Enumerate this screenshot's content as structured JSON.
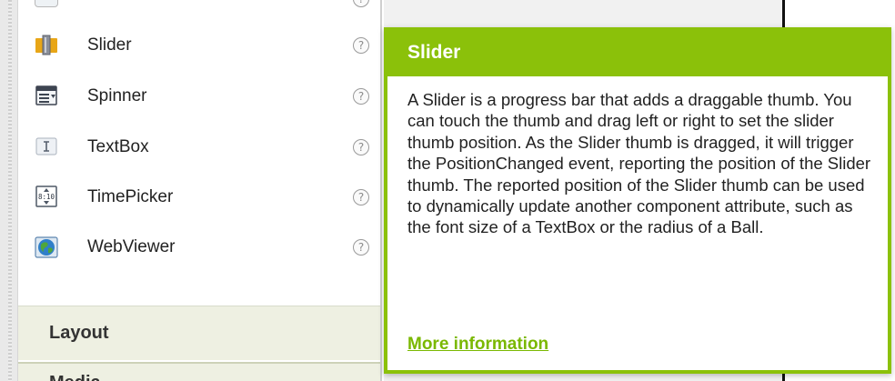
{
  "palette": {
    "items": [
      {
        "label": "Slider",
        "icon": "slider-icon",
        "help": "?"
      },
      {
        "label": "Spinner",
        "icon": "spinner-icon",
        "help": "?"
      },
      {
        "label": "TextBox",
        "icon": "textbox-icon",
        "help": "?"
      },
      {
        "label": "TimePicker",
        "icon": "timepicker-icon",
        "help": "?"
      },
      {
        "label": "WebViewer",
        "icon": "webviewer-icon",
        "help": "?"
      }
    ],
    "top_help": "?",
    "categories": [
      {
        "label": "Layout"
      },
      {
        "label": "Media"
      }
    ]
  },
  "popup": {
    "title": "Slider",
    "description": "A Slider is a progress bar that adds a draggable thumb. You can touch the thumb and drag left or right to set the slider thumb position. As the Slider thumb is dragged, it will trigger the PositionChanged event, reporting the position of the Slider thumb. The reported position of the Slider thumb can be used to dynamically update another component attribute, such as the font size of a TextBox or the radius of a Ball.",
    "link_text": "More information"
  },
  "colors": {
    "accent": "#8bc10a",
    "link": "#7ab800",
    "category_bg": "#eef0e2"
  }
}
